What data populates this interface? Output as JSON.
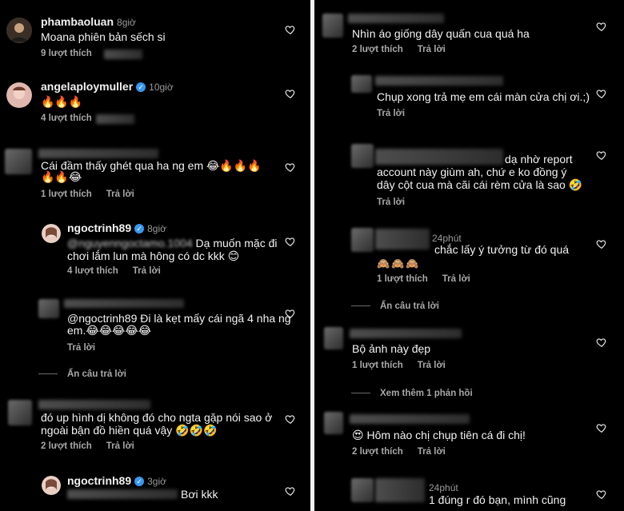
{
  "left": {
    "c1": {
      "user": "phambaoluan",
      "time": "8giờ",
      "text": "Moana phiên bản sếch si",
      "likes": "9 lượt thích"
    },
    "c2": {
      "user": "angelaploymuller",
      "time": "10giờ",
      "text": "🔥🔥🔥",
      "likes": "4 lượt thích"
    },
    "c3": {
      "text1": "Cái đầm thấy ghét qua ha ng em 😂🔥🔥🔥",
      "text2": "🔥🔥😂",
      "likes": "1 lượt thích",
      "reply": "Trả lời"
    },
    "c4": {
      "user": "ngoctrinh89",
      "time": "8giờ",
      "mention": "@nguyenngoctamo.1004",
      "text1": " Dạ muốn mặc đi",
      "text2": "chơi lắm lun mà hông có dc kkk 😊",
      "likes": "4 lượt thích",
      "reply": "Trả lời"
    },
    "c5": {
      "text1": "@ngoctrinh89 Đi là kẹt mấy cái ngã 4 nha ng",
      "text2": "em.😂😂😂😂😂",
      "reply": "Trả lời",
      "hide": "Ẩn câu trả lời"
    },
    "c6": {
      "text1": "đó up hình dị không đó cho ngta gặp nói sao ở",
      "text2": "ngoài bận đồ hiền quá vậy 🤣🤣🤣",
      "likes": "2 lượt thích",
      "reply": "Trả lời"
    },
    "c7": {
      "user": "ngoctrinh89",
      "time": "3giờ",
      "text": "Bơi kkk"
    }
  },
  "right": {
    "c1": {
      "text": "Nhìn áo giống dây quấn cua quá ha",
      "likes": "2 lượt thích",
      "reply": "Trả lời"
    },
    "c2": {
      "text": "Chụp xong trả mẹ em cái màn cửa chị ơi.;)",
      "reply": "Trả lời"
    },
    "c3": {
      "text1": "dạ nhờ report",
      "text2": "account này giùm ah, chứ e ko đồng ý",
      "text3": "dây cột cua mà cãi cái rèm cửa là sao 🤣",
      "reply": "Trả lời"
    },
    "c4": {
      "time": "24phút",
      "text": "chắc lấy ý tưởng từ đó quá",
      "emoji": "🙈🙈🙈",
      "likes": "1 lượt thích",
      "reply": "Trả lời",
      "hide": "Ẩn câu trả lời"
    },
    "c5": {
      "text": "Bộ ảnh này đẹp",
      "likes": "1 lượt thích",
      "reply": "Trả lời",
      "more": "Xem thêm 1 phản hồi"
    },
    "c6": {
      "text": "😍 Hôm nào chị chụp tiên cá đi chị!",
      "likes": "2 lượt thích",
      "reply": "Trả lời"
    },
    "c7": {
      "time": "24phút",
      "text": "1 đúng r đó bạn, mình cũng"
    }
  },
  "colors": {
    "background": "#000000",
    "text": "#f2f2f2",
    "meta": "#a8a8a8",
    "verified": "#3897f0"
  }
}
